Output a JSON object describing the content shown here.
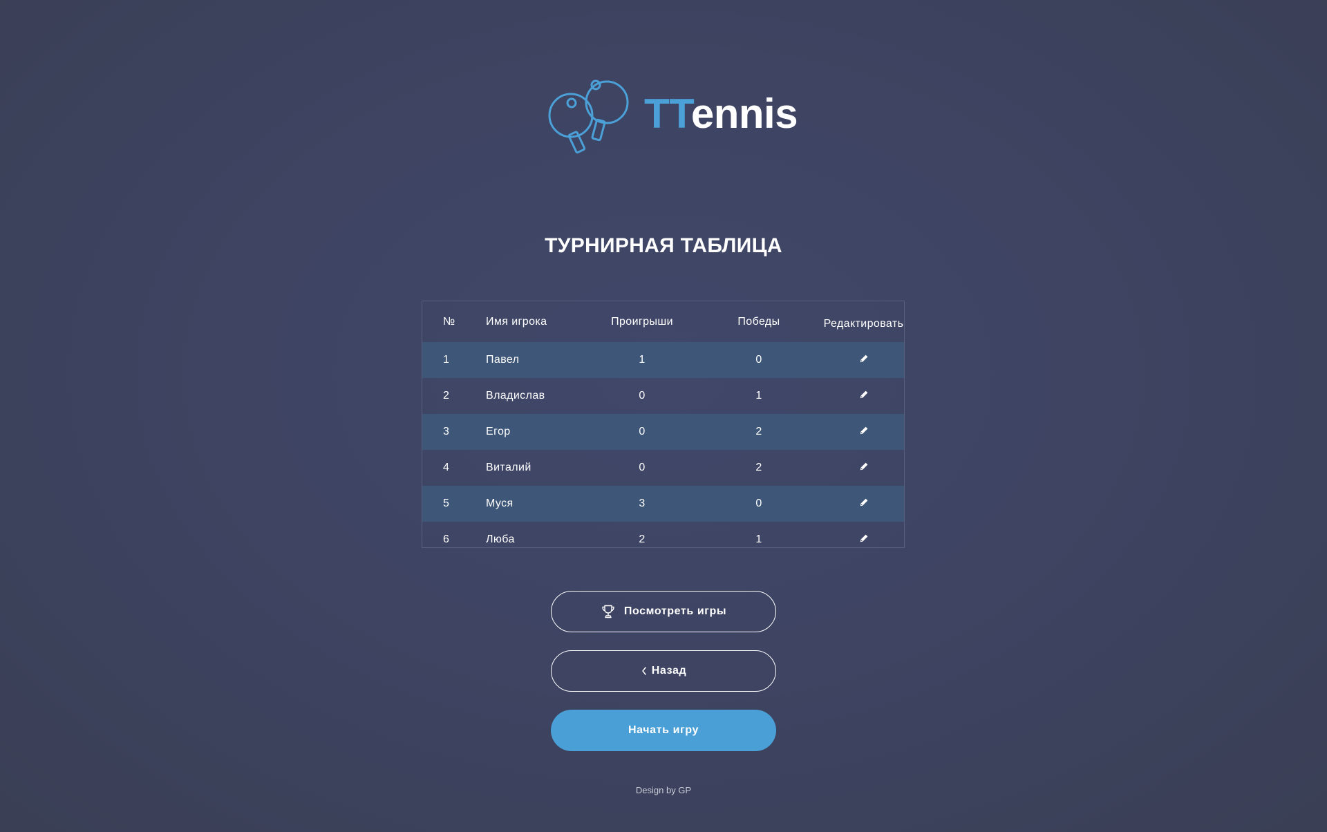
{
  "brand": {
    "name_accent": "TT",
    "name_rest": "ennis",
    "accent_color": "#4ca0d8"
  },
  "page_title": "ТУРНИРНАЯ ТАБЛИЦА",
  "table": {
    "headers": {
      "num": "№",
      "name": "Имя игрока",
      "losses": "Проигрыши",
      "wins": "Победы",
      "edit": "Редактировать"
    },
    "rows": [
      {
        "num": "1",
        "name": "Павел",
        "losses": "1",
        "wins": "0",
        "edit_icon": "pencil-icon"
      },
      {
        "num": "2",
        "name": "Владислав",
        "losses": "0",
        "wins": "1",
        "edit_icon": "pencil-icon"
      },
      {
        "num": "3",
        "name": "Егор",
        "losses": "0",
        "wins": "2",
        "edit_icon": "pencil-icon"
      },
      {
        "num": "4",
        "name": "Виталий",
        "losses": "0",
        "wins": "2",
        "edit_icon": "pencil-icon"
      },
      {
        "num": "5",
        "name": "Муся",
        "losses": "3",
        "wins": "0",
        "edit_icon": "pencil-icon"
      },
      {
        "num": "6",
        "name": "Люба",
        "losses": "2",
        "wins": "1",
        "edit_icon": "pencil-icon"
      }
    ],
    "stripe_color": "#3e5677"
  },
  "buttons": {
    "view_games": {
      "label": "Посмотреть игры",
      "icon": "trophy-icon"
    },
    "back": {
      "label": "Назад",
      "icon": "chevron-left-icon"
    },
    "start": {
      "label": "Начать игру",
      "color": "#4aa0d6"
    }
  },
  "footer": "Design by GP"
}
